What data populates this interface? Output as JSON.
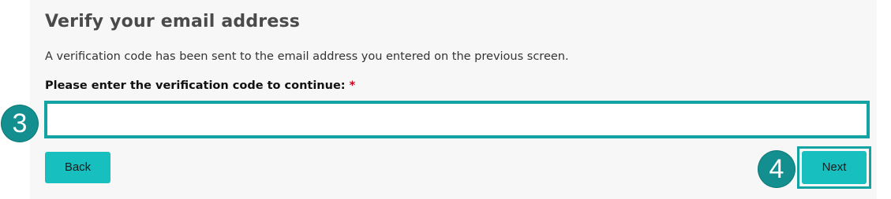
{
  "heading": "Verify your email address",
  "description": "A verification code has been sent to the email address you entered on the previous screen.",
  "code_field": {
    "label": "Please enter the verification code to continue:",
    "required_mark": "*",
    "value": "",
    "placeholder": ""
  },
  "buttons": {
    "back_label": "Back",
    "next_label": "Next"
  },
  "step_markers": {
    "input_step": "3",
    "next_step": "4"
  },
  "colors": {
    "accent": "#17bfbf",
    "highlight": "#14a3a3",
    "marker": "#138f8f",
    "required": "#d0021b",
    "panel_bg": "#f7f7f7"
  }
}
